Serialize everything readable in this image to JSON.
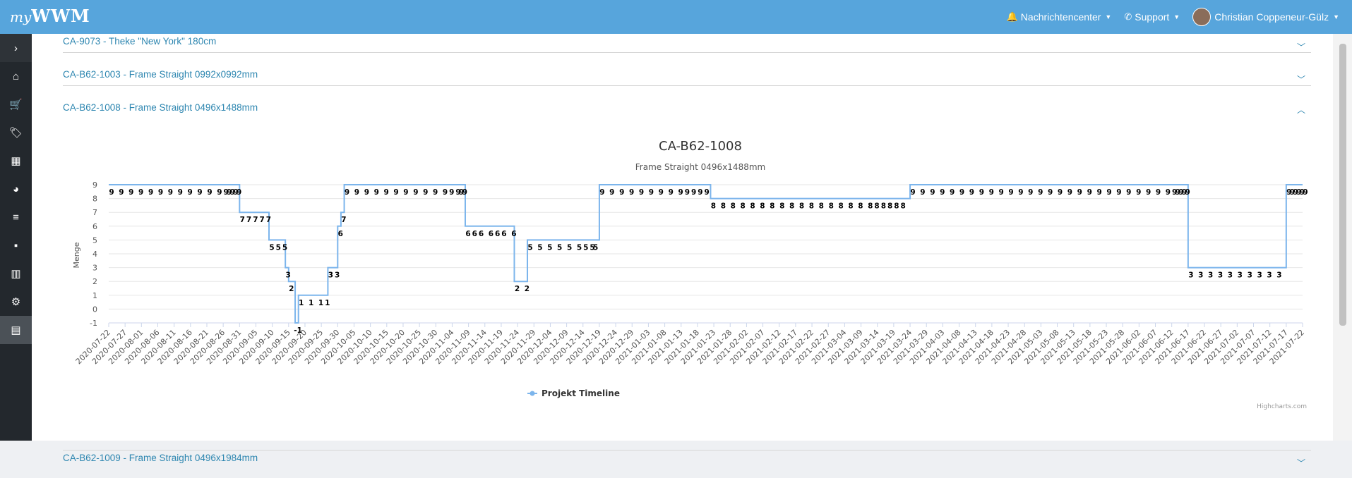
{
  "header": {
    "logo_prefix": "my",
    "logo_main": "WWM",
    "notifications_label": "Nachrichtencenter",
    "support_label": "Support",
    "user_name": "Christian Coppeneur-Gülz"
  },
  "sidebar": {
    "items": [
      {
        "icon": "chevron-right-icon",
        "glyph": "›"
      },
      {
        "icon": "home-icon",
        "glyph": "⌂"
      },
      {
        "icon": "cart-icon",
        "glyph": "🛒"
      },
      {
        "icon": "tags-icon",
        "glyph": "🏷"
      },
      {
        "icon": "calendar-icon",
        "glyph": "▦"
      },
      {
        "icon": "pie-chart-icon",
        "glyph": "◕"
      },
      {
        "icon": "list-icon",
        "glyph": "≡"
      },
      {
        "icon": "cubes-icon",
        "glyph": "▪"
      },
      {
        "icon": "bar-chart-icon",
        "glyph": "▥"
      },
      {
        "icon": "gear-icon",
        "glyph": "⚙"
      },
      {
        "icon": "document-icon",
        "glyph": "▤"
      }
    ]
  },
  "accordion": [
    {
      "title": "CA-9073 - Theke \"New York\" 180cm",
      "expanded": false
    },
    {
      "title": "CA-B62-1003 - Frame Straight 0992x0992mm",
      "expanded": false
    },
    {
      "title": "CA-B62-1008 - Frame Straight 0496x1488mm",
      "expanded": true
    },
    {
      "title": "CA-B62-1009 - Frame Straight 0496x1984mm",
      "expanded": false
    }
  ],
  "chart_data": {
    "type": "line",
    "step": true,
    "title": "CA-B62-1008",
    "subtitle": "Frame Straight 0496x1488mm",
    "ylabel": "Menge",
    "ylim": [
      -1,
      9
    ],
    "yticks": [
      -1,
      0,
      1,
      2,
      3,
      4,
      5,
      6,
      7,
      8,
      9
    ],
    "xlim": [
      "2020-07-22",
      "2021-07-22"
    ],
    "xtick_interval_days": 5,
    "grid": true,
    "legend_position": "bottom-center",
    "credits": "Highcharts.com",
    "color": "#7cb5ec",
    "series": [
      {
        "name": "Projekt Timeline",
        "points": [
          [
            "2020-07-22",
            9
          ],
          [
            "2020-07-25",
            9
          ],
          [
            "2020-07-28",
            9
          ],
          [
            "2020-07-31",
            9
          ],
          [
            "2020-08-03",
            9
          ],
          [
            "2020-08-06",
            9
          ],
          [
            "2020-08-09",
            9
          ],
          [
            "2020-08-12",
            9
          ],
          [
            "2020-08-15",
            9
          ],
          [
            "2020-08-18",
            9
          ],
          [
            "2020-08-21",
            9
          ],
          [
            "2020-08-24",
            9
          ],
          [
            "2020-08-26",
            9
          ],
          [
            "2020-08-27",
            9
          ],
          [
            "2020-08-28",
            9
          ],
          [
            "2020-08-29",
            9
          ],
          [
            "2020-08-30",
            9
          ],
          [
            "2020-08-31",
            7
          ],
          [
            "2020-09-02",
            7
          ],
          [
            "2020-09-04",
            7
          ],
          [
            "2020-09-06",
            7
          ],
          [
            "2020-09-08",
            7
          ],
          [
            "2020-09-09",
            5
          ],
          [
            "2020-09-11",
            5
          ],
          [
            "2020-09-13",
            5
          ],
          [
            "2020-09-14",
            3
          ],
          [
            "2020-09-15",
            2
          ],
          [
            "2020-09-17",
            -1
          ],
          [
            "2020-09-18",
            1
          ],
          [
            "2020-09-21",
            1
          ],
          [
            "2020-09-24",
            1
          ],
          [
            "2020-09-26",
            1
          ],
          [
            "2020-09-27",
            3
          ],
          [
            "2020-09-29",
            3
          ],
          [
            "2020-09-30",
            6
          ],
          [
            "2020-10-01",
            7
          ],
          [
            "2020-10-02",
            9
          ],
          [
            "2020-10-05",
            9
          ],
          [
            "2020-10-08",
            9
          ],
          [
            "2020-10-11",
            9
          ],
          [
            "2020-10-14",
            9
          ],
          [
            "2020-10-17",
            9
          ],
          [
            "2020-10-20",
            9
          ],
          [
            "2020-10-23",
            9
          ],
          [
            "2020-10-26",
            9
          ],
          [
            "2020-10-29",
            9
          ],
          [
            "2020-11-01",
            9
          ],
          [
            "2020-11-03",
            9
          ],
          [
            "2020-11-05",
            9
          ],
          [
            "2020-11-06",
            9
          ],
          [
            "2020-11-07",
            9
          ],
          [
            "2020-11-08",
            6
          ],
          [
            "2020-11-10",
            6
          ],
          [
            "2020-11-12",
            6
          ],
          [
            "2020-11-15",
            6
          ],
          [
            "2020-11-17",
            6
          ],
          [
            "2020-11-19",
            6
          ],
          [
            "2020-11-22",
            6
          ],
          [
            "2020-11-23",
            2
          ],
          [
            "2020-11-26",
            2
          ],
          [
            "2020-11-27",
            5
          ],
          [
            "2020-11-30",
            5
          ],
          [
            "2020-12-03",
            5
          ],
          [
            "2020-12-06",
            5
          ],
          [
            "2020-12-09",
            5
          ],
          [
            "2020-12-12",
            5
          ],
          [
            "2020-12-14",
            5
          ],
          [
            "2020-12-16",
            5
          ],
          [
            "2020-12-17",
            5
          ],
          [
            "2020-12-19",
            9
          ],
          [
            "2020-12-22",
            9
          ],
          [
            "2020-12-25",
            9
          ],
          [
            "2020-12-28",
            9
          ],
          [
            "2020-12-31",
            9
          ],
          [
            "2021-01-03",
            9
          ],
          [
            "2021-01-06",
            9
          ],
          [
            "2021-01-09",
            9
          ],
          [
            "2021-01-12",
            9
          ],
          [
            "2021-01-14",
            9
          ],
          [
            "2021-01-16",
            9
          ],
          [
            "2021-01-18",
            9
          ],
          [
            "2021-01-20",
            9
          ],
          [
            "2021-01-22",
            8
          ],
          [
            "2021-01-25",
            8
          ],
          [
            "2021-01-28",
            8
          ],
          [
            "2021-01-31",
            8
          ],
          [
            "2021-02-03",
            8
          ],
          [
            "2021-02-06",
            8
          ],
          [
            "2021-02-09",
            8
          ],
          [
            "2021-02-12",
            8
          ],
          [
            "2021-02-15",
            8
          ],
          [
            "2021-02-18",
            8
          ],
          [
            "2021-02-21",
            8
          ],
          [
            "2021-02-24",
            8
          ],
          [
            "2021-02-27",
            8
          ],
          [
            "2021-03-02",
            8
          ],
          [
            "2021-03-05",
            8
          ],
          [
            "2021-03-08",
            8
          ],
          [
            "2021-03-11",
            8
          ],
          [
            "2021-03-13",
            8
          ],
          [
            "2021-03-15",
            8
          ],
          [
            "2021-03-17",
            8
          ],
          [
            "2021-03-19",
            8
          ],
          [
            "2021-03-21",
            8
          ],
          [
            "2021-03-24",
            9
          ],
          [
            "2021-03-27",
            9
          ],
          [
            "2021-03-30",
            9
          ],
          [
            "2021-04-02",
            9
          ],
          [
            "2021-04-05",
            9
          ],
          [
            "2021-04-08",
            9
          ],
          [
            "2021-04-11",
            9
          ],
          [
            "2021-04-14",
            9
          ],
          [
            "2021-04-17",
            9
          ],
          [
            "2021-04-20",
            9
          ],
          [
            "2021-04-23",
            9
          ],
          [
            "2021-04-26",
            9
          ],
          [
            "2021-04-29",
            9
          ],
          [
            "2021-05-02",
            9
          ],
          [
            "2021-05-05",
            9
          ],
          [
            "2021-05-08",
            9
          ],
          [
            "2021-05-11",
            9
          ],
          [
            "2021-05-14",
            9
          ],
          [
            "2021-05-17",
            9
          ],
          [
            "2021-05-20",
            9
          ],
          [
            "2021-05-23",
            9
          ],
          [
            "2021-05-26",
            9
          ],
          [
            "2021-05-29",
            9
          ],
          [
            "2021-06-01",
            9
          ],
          [
            "2021-06-04",
            9
          ],
          [
            "2021-06-07",
            9
          ],
          [
            "2021-06-10",
            9
          ],
          [
            "2021-06-12",
            9
          ],
          [
            "2021-06-13",
            9
          ],
          [
            "2021-06-14",
            9
          ],
          [
            "2021-06-15",
            9
          ],
          [
            "2021-06-16",
            9
          ],
          [
            "2021-06-17",
            3
          ],
          [
            "2021-06-20",
            3
          ],
          [
            "2021-06-23",
            3
          ],
          [
            "2021-06-26",
            3
          ],
          [
            "2021-06-29",
            3
          ],
          [
            "2021-07-02",
            3
          ],
          [
            "2021-07-05",
            3
          ],
          [
            "2021-07-08",
            3
          ],
          [
            "2021-07-11",
            3
          ],
          [
            "2021-07-14",
            3
          ],
          [
            "2021-07-17",
            9
          ],
          [
            "2021-07-18",
            9
          ],
          [
            "2021-07-19",
            9
          ],
          [
            "2021-07-20",
            9
          ],
          [
            "2021-07-21",
            9
          ],
          [
            "2021-07-22",
            9
          ]
        ]
      }
    ]
  }
}
